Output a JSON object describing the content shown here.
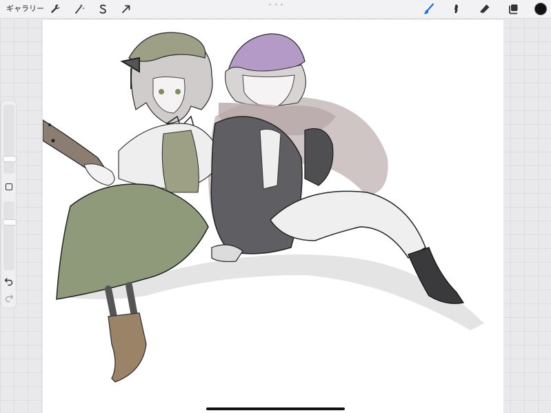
{
  "toolbar": {
    "gallery_label": "ギャラリー",
    "left_tools": [
      {
        "name": "actions-wrench-icon"
      },
      {
        "name": "adjustments-magic-wand-icon"
      },
      {
        "name": "selection-s-icon"
      },
      {
        "name": "transform-arrow-icon"
      }
    ],
    "right_tools": [
      {
        "name": "brush-icon",
        "active": true,
        "color": "#1a6fe0"
      },
      {
        "name": "smudge-icon",
        "active": false
      },
      {
        "name": "eraser-icon",
        "active": false
      },
      {
        "name": "layers-icon",
        "active": false
      }
    ],
    "current_color": "#111111"
  },
  "sidebar": {
    "brush_size_level": 0.35,
    "opacity_level": 0.28
  },
  "canvas": {
    "background": "#ffffff",
    "palette": {
      "skirt_green": "#8f9a7a",
      "beret_green": "#9ea086",
      "coat_gray": "#5f5f63",
      "hat_purple": "#b39ac7",
      "shadow_brown": "#a79595",
      "boot_brown": "#9a8366",
      "line": "#222222"
    }
  }
}
